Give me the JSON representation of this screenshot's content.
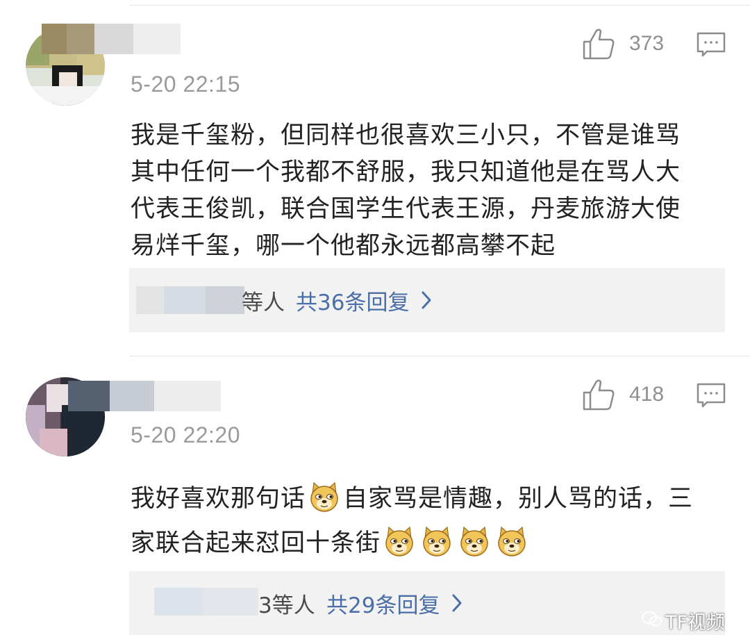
{
  "comments": [
    {
      "timestamp": "5-20 22:15",
      "likes": "373",
      "lines": [
        "我是千玺粉，但同样也很喜欢三小只，不管是谁骂",
        "其中任何一个我都不舒服，我只知道他是在骂人大",
        "代表王俊凯，联合国学生代表王源，丹麦旅游大使",
        "易烊千玺，哪一个他都永远都高攀不起"
      ],
      "replies": {
        "suffix": "等人",
        "count_label": "共36条回复"
      }
    },
    {
      "timestamp": "5-20 22:20",
      "likes": "418",
      "line1_a": "我好喜欢那句话",
      "line1_b": "自家骂是情趣，别人骂的话，三",
      "line2": "家联合起来怼回十条街",
      "replies": {
        "suffix": "3等人",
        "count_label": "共29条回复"
      }
    }
  ],
  "icons": {
    "like": "thumbs-up-icon",
    "reply": "comment-bubble-icon",
    "more": "chevron-right-icon",
    "emoji": "doge-emoji"
  },
  "watermark": "TF视频",
  "colors": {
    "link": "#4a6ea8",
    "text": "#222222",
    "muted": "#9a9a9a",
    "reply_bg": "#f2f2f2"
  }
}
